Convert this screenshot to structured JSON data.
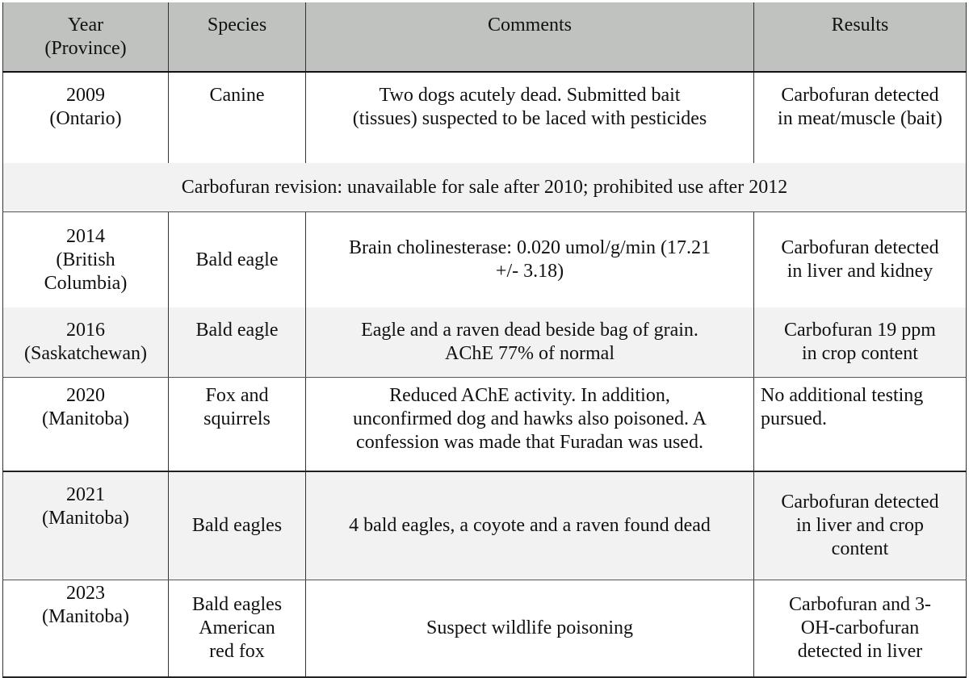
{
  "table": {
    "headers": {
      "year": [
        "Year",
        "(Province)"
      ],
      "species": "Species",
      "comments": "Comments",
      "results": "Results"
    },
    "rows": [
      {
        "year": "2009",
        "province": "(Ontario)",
        "species": [
          "Canine"
        ],
        "comments": [
          "Two dogs acutely dead.  Submitted bait",
          "(tissues) suspected to be laced with pesticides"
        ],
        "results": [
          "Carbofuran detected",
          "in meat/muscle (bait)"
        ]
      },
      {
        "year": "2014",
        "province": [
          "(British",
          "Columbia)"
        ],
        "species": [
          "Bald eagle"
        ],
        "comments": [
          "Brain cholinesterase: 0.020 umol/g/min (17.21",
          "+/- 3.18)"
        ],
        "results": [
          "Carbofuran detected",
          "in liver and kidney"
        ]
      },
      {
        "year": "2016",
        "province": "(Saskatchewan)",
        "species": [
          "Bald eagle"
        ],
        "comments": [
          "Eagle and a raven dead beside bag of grain.",
          "AChE 77% of normal"
        ],
        "results": [
          "Carbofuran 19 ppm",
          "in crop content"
        ]
      },
      {
        "year": "2020",
        "province": "(Manitoba)",
        "species": [
          "Fox and",
          "squirrels"
        ],
        "comments": [
          "Reduced AChE activity.  In addition,",
          "unconfirmed dog and hawks also poisoned. A",
          "confession was made that Furadan was used."
        ],
        "results": [
          "No additional testing",
          "pursued."
        ]
      },
      {
        "year": "2021",
        "province": "(Manitoba)",
        "species": [
          "Bald eagles"
        ],
        "comments": [
          "4 bald eagles, a coyote and a raven found dead"
        ],
        "results": [
          "Carbofuran detected",
          "in liver and crop",
          "content"
        ]
      },
      {
        "year": "2023",
        "province": "(Manitoba)",
        "species": [
          "Bald eagles",
          "American",
          "red fox"
        ],
        "comments": [
          "Suspect wildlife poisoning"
        ],
        "results": [
          "Carbofuran and 3-",
          "OH-carbofuran",
          "detected in liver"
        ]
      }
    ],
    "banner": "Carbofuran revision:  unavailable for sale after 2010; prohibited use after 2012"
  },
  "colors": {
    "header_bg": "#c0c2c0",
    "alt_row_bg": "#f2f2f2",
    "row_bg": "#ffffff",
    "text": "#111111"
  }
}
